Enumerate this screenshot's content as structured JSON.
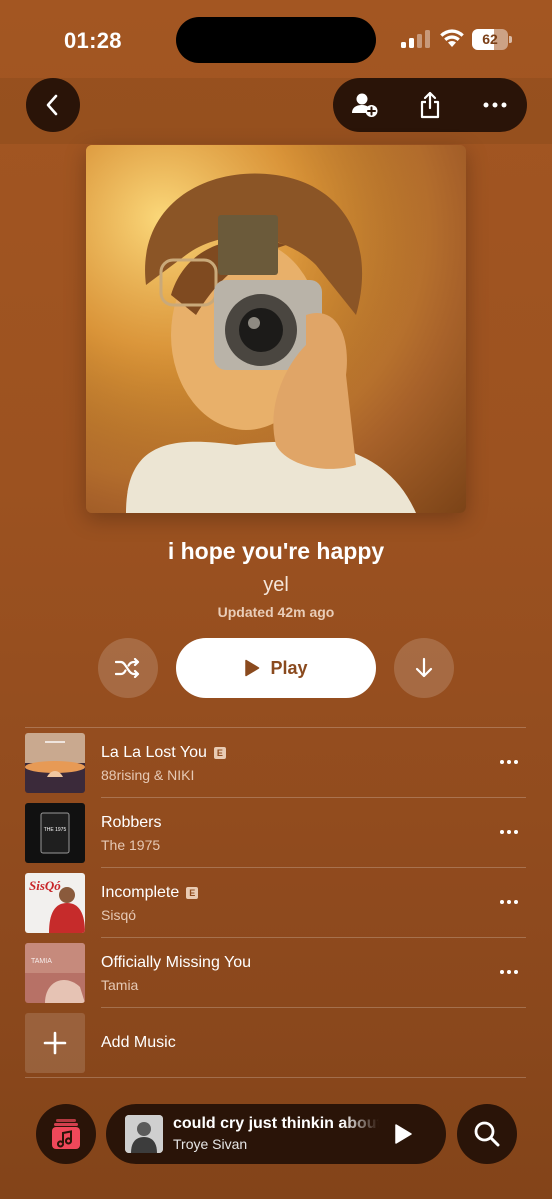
{
  "status_bar": {
    "time": "01:28",
    "battery": "62",
    "battery_level": 0.62,
    "icons": [
      "signal-icon",
      "wifi-icon",
      "battery-icon"
    ]
  },
  "nav": {
    "back_icon": "chevron-left-icon",
    "actions": [
      "add-collaborator-icon",
      "share-icon",
      "more-icon"
    ]
  },
  "playlist": {
    "title": "i hope you're happy",
    "owner": "yel",
    "updated": "Updated 42m ago",
    "play_label": "Play",
    "controls": [
      "shuffle-icon",
      "play-icon",
      "download-icon"
    ]
  },
  "tracks": [
    {
      "title": "La La Lost You",
      "artist": "88rising & NIKI",
      "explicit": true,
      "explicit_mark": "E"
    },
    {
      "title": "Robbers",
      "artist": "The 1975",
      "explicit": false,
      "art_text": "THE 1975"
    },
    {
      "title": "Incomplete",
      "artist": "Sisqó",
      "explicit": true,
      "explicit_mark": "E",
      "art_text": "SisQó"
    },
    {
      "title": "Officially Missing You",
      "artist": "Tamia",
      "explicit": false,
      "art_text": "TAMIA"
    }
  ],
  "add_music": {
    "label": "Add Music",
    "icon": "plus-icon"
  },
  "mini_player": {
    "title": "could cry just thinkin about you",
    "artist": "Troye Sivan",
    "icon": "play-icon"
  },
  "bottom": {
    "left_icon": "music-library-icon",
    "right_icon": "search-icon"
  },
  "colors": {
    "background": "#9c5220",
    "dark_button": "#2a1408",
    "accent_text": "#8a4a1e",
    "library_red": "#f0485a"
  }
}
